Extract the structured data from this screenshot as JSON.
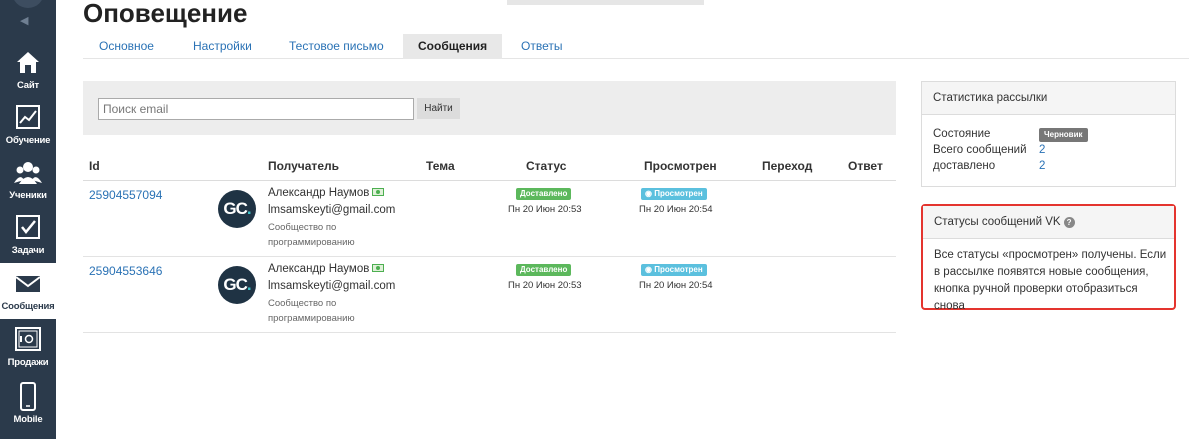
{
  "sidebar": {
    "items": [
      {
        "label": "Сайт",
        "icon": "home-icon"
      },
      {
        "label": "Обучение",
        "icon": "chart-icon"
      },
      {
        "label": "Ученики",
        "icon": "users-icon"
      },
      {
        "label": "Задачи",
        "icon": "checkbox-icon"
      },
      {
        "label": "Сообщения",
        "icon": "envelope-icon",
        "active": true
      },
      {
        "label": "Продажи",
        "icon": "safe-icon"
      },
      {
        "label": "Mobile",
        "icon": "phone-icon"
      }
    ]
  },
  "header": {
    "title": "Оповещение"
  },
  "tabs": [
    {
      "label": "Основное"
    },
    {
      "label": "Настройки"
    },
    {
      "label": "Тестовое письмо"
    },
    {
      "label": "Сообщения",
      "active": true
    },
    {
      "label": "Ответы"
    }
  ],
  "search": {
    "placeholder": "Поиск email",
    "button_label": "Найти"
  },
  "table": {
    "columns": [
      "Id",
      "Получатель",
      "Тема",
      "Статус",
      "Просмотрен",
      "Переход",
      "Ответ"
    ],
    "rows": [
      {
        "id": "25904557094",
        "avatar_text": "GC",
        "avatar_dot": ".",
        "name": "Александр Наумов",
        "email": "lmsamskeyti@gmail.com",
        "group": "Сообщество по программированию",
        "status_badge": "Доставлено",
        "status_date": "Пн 20 Июн 20:53",
        "viewed_badge": "Просмотрен",
        "viewed_date": "Пн 20 Июн 20:54"
      },
      {
        "id": "25904553646",
        "avatar_text": "GC",
        "avatar_dot": ".",
        "name": "Александр Наумов",
        "email": "lmsamskeyti@gmail.com",
        "group": "Сообщество по программированию",
        "status_badge": "Доставлено",
        "status_date": "Пн 20 Июн 20:53",
        "viewed_badge": "Просмотрен",
        "viewed_date": "Пн 20 Июн 20:54"
      }
    ]
  },
  "stats_panel": {
    "title": "Статистика рассылки",
    "state_label": "Состояние",
    "state_value": "Черновик",
    "total_label": "Всего сообщений",
    "total_value": "2",
    "delivered_label": "доставлено",
    "delivered_value": "2"
  },
  "vk_panel": {
    "title": "Статусы сообщений VK",
    "text": "Все статусы «просмотрен» получены. Если в рассылке появятся новые сообщения, кнопка ручной проверки отобразиться снова"
  },
  "colors": {
    "sidebar_bg": "#2b3a4b",
    "link": "#2a72b5",
    "delivered_badge": "#5cb85c",
    "viewed_badge": "#5bc0de",
    "highlight_border": "#e4342e"
  }
}
